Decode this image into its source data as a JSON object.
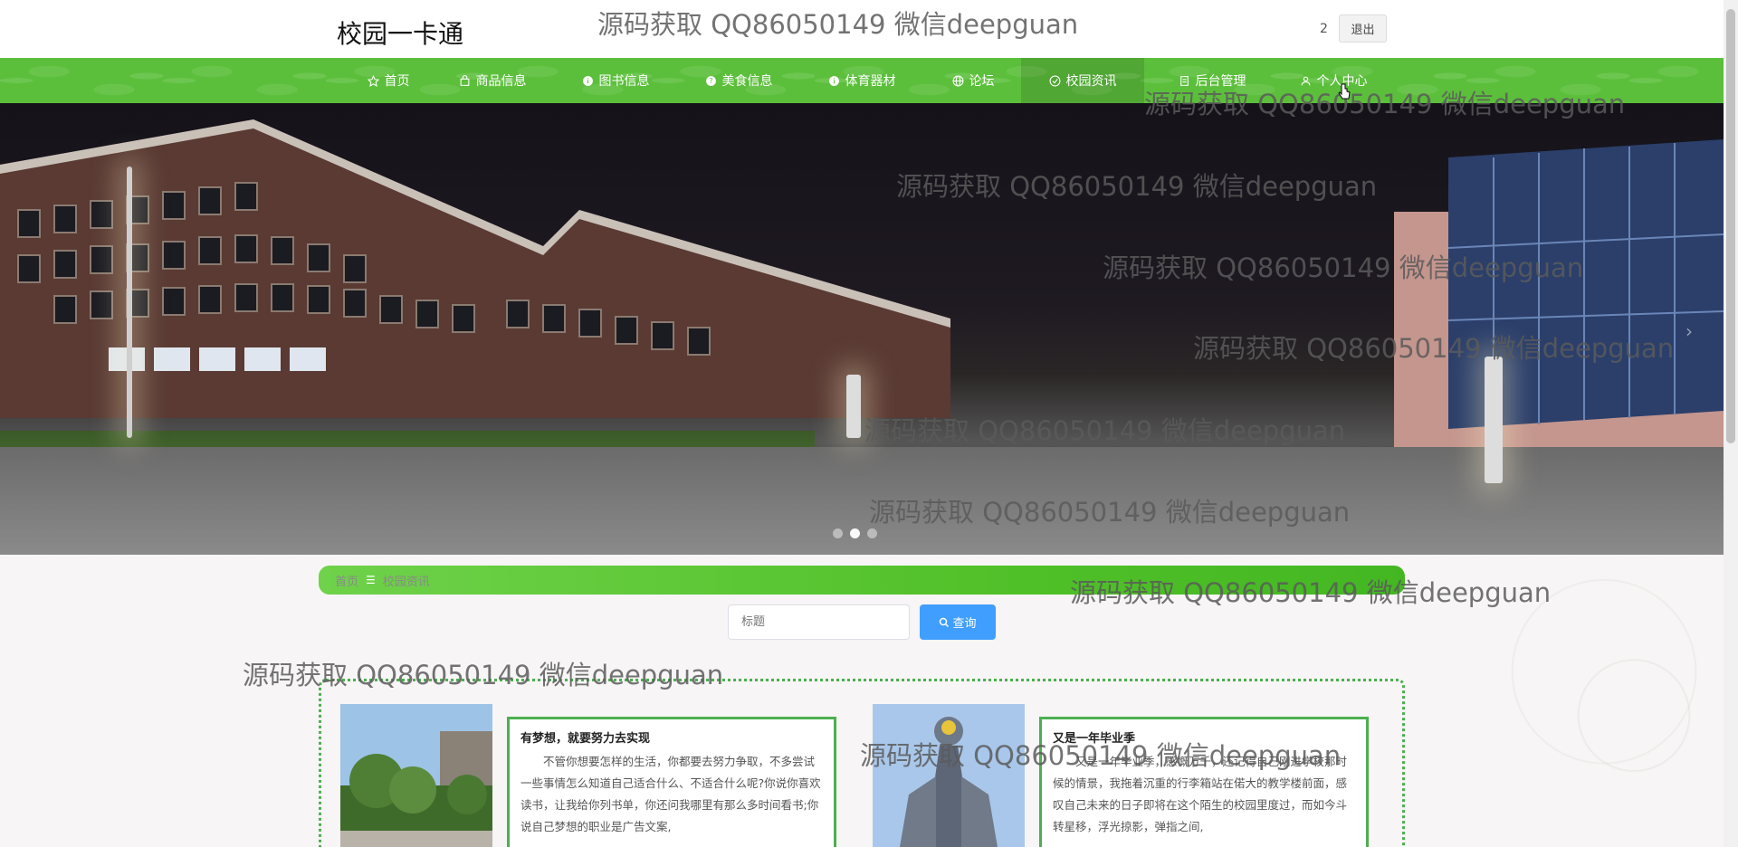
{
  "header": {
    "site_title": "校园一卡通",
    "user_label": "2",
    "logout_label": "退出"
  },
  "nav": {
    "items": [
      {
        "label": "首页",
        "icon": "star-icon"
      },
      {
        "label": "商品信息",
        "icon": "shop-icon"
      },
      {
        "label": "图书信息",
        "icon": "info-icon"
      },
      {
        "label": "美食信息",
        "icon": "question-icon"
      },
      {
        "label": "体育器材",
        "icon": "info-icon"
      },
      {
        "label": "论坛",
        "icon": "globe-icon"
      },
      {
        "label": "校园资讯",
        "icon": "check-circle-icon"
      },
      {
        "label": "后台管理",
        "icon": "document-icon"
      },
      {
        "label": "个人中心",
        "icon": "user-icon"
      }
    ],
    "active_index": 6
  },
  "banner": {
    "slide_count": 3,
    "active_slide": 1
  },
  "breadcrumb": {
    "home": "首页",
    "separator": "☰",
    "current": "校园资讯"
  },
  "search": {
    "placeholder": "标题",
    "button_label": "查询"
  },
  "news": [
    {
      "title": "有梦想，就要努力去实现",
      "body": "不管你想要怎样的生活，你都要去努力争取，不多尝试一些事情怎么知道自己适合什么、不适合什么呢?你说你喜欢读书，让我给你列书单，你还问我哪里有那么多时间看书;你说自己梦想的职业是广告文案,"
    },
    {
      "title": "又是一年毕业季",
      "body": "又是一年毕业季，感慨万千，还记得自己刚进学校那时候的情景，我拖着沉重的行李箱站在偌大的教学楼前面，感叹自己未来的日子即将在这个陌生的校园里度过，而如今斗转星移，浮光掠影，弹指之间,"
    }
  ],
  "watermark_text": "源码获取 QQ86050149 微信deepguan",
  "colors": {
    "nav_green": "#5cbf3c",
    "breadcrumb_green": "#52c12a",
    "button_blue": "#409eff",
    "card_border": "#4caf50"
  }
}
